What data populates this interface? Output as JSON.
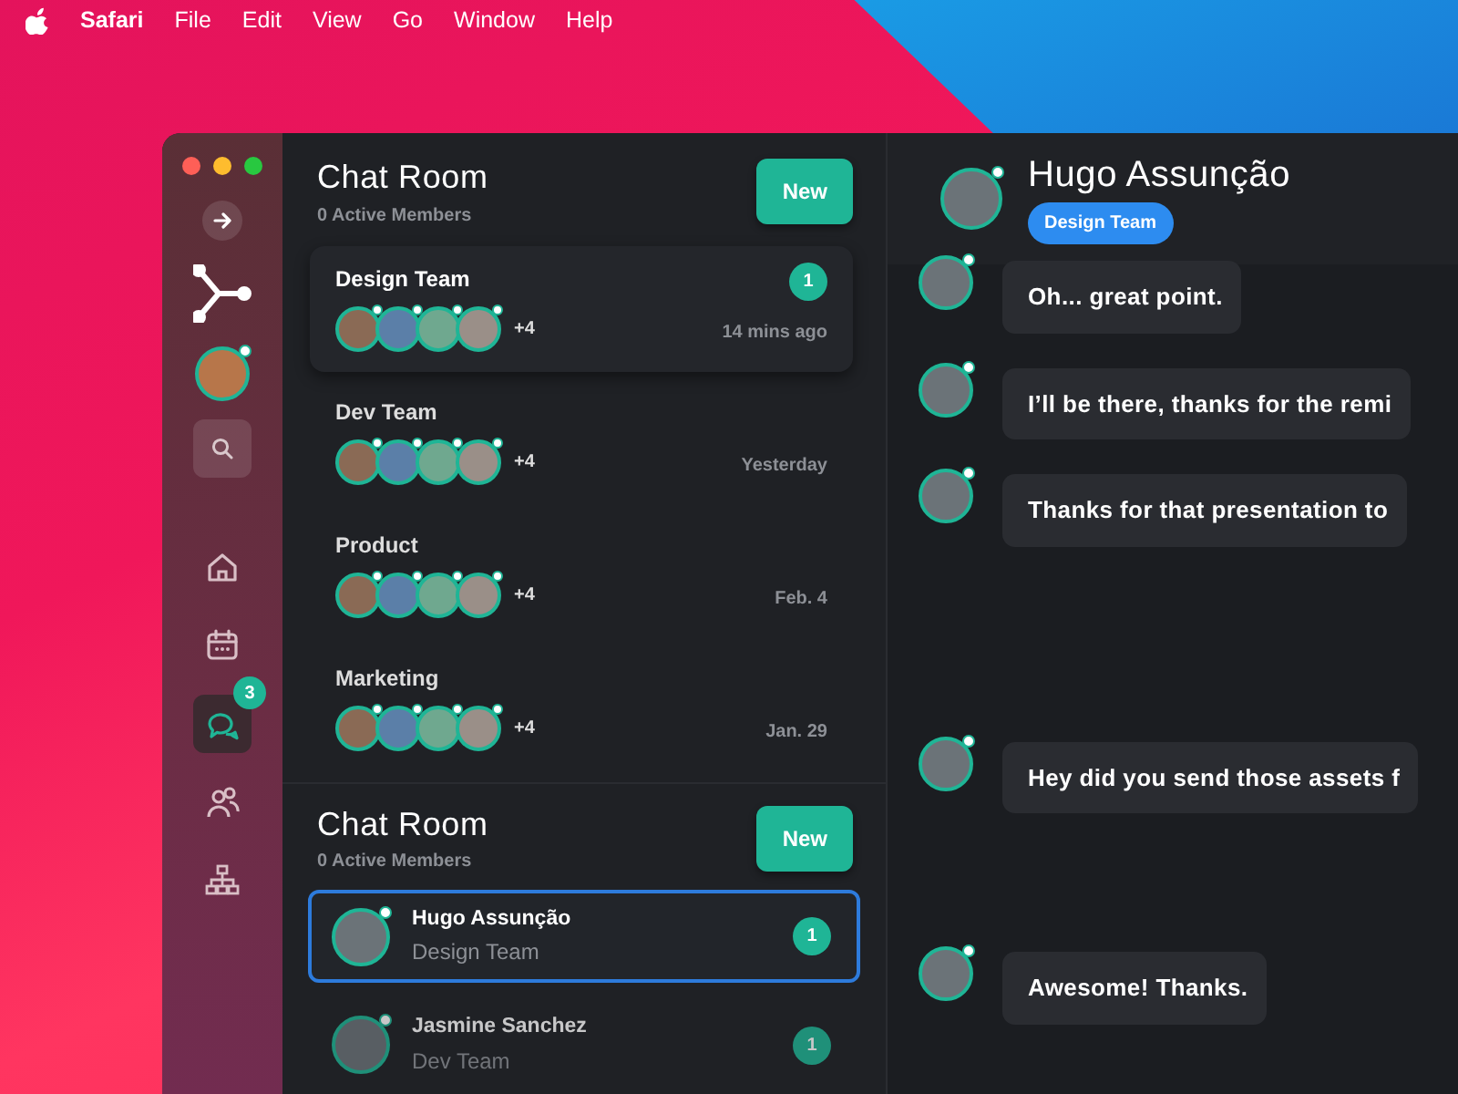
{
  "menu_bar": {
    "app": "Safari",
    "items": [
      "File",
      "Edit",
      "View",
      "Go",
      "Window",
      "Help"
    ]
  },
  "sidebar": {
    "nav": [
      {
        "kind": "home",
        "selected": false
      },
      {
        "kind": "calendar",
        "selected": false
      },
      {
        "kind": "chat",
        "selected": true,
        "badge": "3"
      },
      {
        "kind": "people",
        "selected": false
      },
      {
        "kind": "hierarchy",
        "selected": false
      }
    ]
  },
  "groups": {
    "title": "Chat Room",
    "subtitle": "0 Active Members",
    "new_button": "New",
    "items": [
      {
        "name": "Design Team",
        "more": "+4",
        "time": "14 mins ago",
        "unread": "1",
        "selected": true
      },
      {
        "name": "Dev Team",
        "more": "+4",
        "time": "Yesterday",
        "selected": false
      },
      {
        "name": "Product",
        "more": "+4",
        "time": "Feb. 4",
        "selected": false
      },
      {
        "name": "Marketing",
        "more": "+4",
        "time": "Jan. 29",
        "selected": false
      }
    ]
  },
  "contacts": {
    "title": "Chat Room",
    "subtitle": "0 Active Members",
    "new_button": "New",
    "items": [
      {
        "name": "Hugo Assunção",
        "team": "Design Team",
        "unread": "1",
        "selected": true
      },
      {
        "name": "Jasmine Sanchez",
        "team": "Dev Team",
        "unread": "1",
        "selected": false
      }
    ]
  },
  "chat": {
    "name": "Hugo Assunção",
    "team": "Design Team",
    "messages": [
      "Oh... great point.",
      "I’ll be there, thanks for the remi",
      "Thanks for that presentation to",
      "Hey did you send those assets f",
      "Awesome! Thanks."
    ]
  }
}
